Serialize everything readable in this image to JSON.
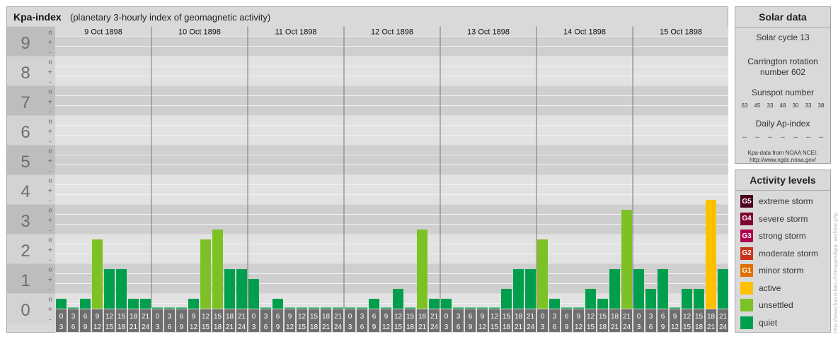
{
  "header": {
    "title": "Kpa-index",
    "subtitle": "(planetary 3-hourly index of geomagnetic activity)"
  },
  "chart_data": {
    "type": "bar",
    "y_levels": [
      "0",
      "1",
      "2",
      "3",
      "4",
      "5",
      "6",
      "7",
      "8",
      "9"
    ],
    "sub_marks": [
      "o",
      "+",
      "-"
    ],
    "ylim": [
      0,
      9
    ],
    "days": [
      "9 Oct 1898",
      "10 Oct 1898",
      "11 Oct 1898",
      "12 Oct 1898",
      "13 Oct 1898",
      "14 Oct 1898",
      "15 Oct 1898"
    ],
    "interval_labels": [
      {
        "from": "0",
        "to": "3"
      },
      {
        "from": "3",
        "to": "6"
      },
      {
        "from": "6",
        "to": "9"
      },
      {
        "from": "9",
        "to": "12"
      },
      {
        "from": "12",
        "to": "15"
      },
      {
        "from": "15",
        "to": "18"
      },
      {
        "from": "18",
        "to": "21"
      },
      {
        "from": "21",
        "to": "24"
      }
    ],
    "values": [
      0.333,
      0,
      0.333,
      2.333,
      1.333,
      1.333,
      0.333,
      0.333,
      0,
      0,
      0,
      0.333,
      2.333,
      2.667,
      1.333,
      1.333,
      1,
      0,
      0.333,
      0,
      0,
      0,
      0,
      0,
      0,
      0,
      0.333,
      0,
      0.667,
      0,
      2.667,
      0.333,
      0.333,
      0,
      0,
      0,
      0,
      0.667,
      1.333,
      1.333,
      2.333,
      0.333,
      0,
      0,
      0.667,
      0.333,
      1.333,
      3.333,
      1.333,
      0.667,
      1.333,
      0,
      0.667,
      0.667,
      3.667,
      1.333
    ]
  },
  "levels": {
    "quiet": {
      "label": "quiet",
      "color": "#009f4d"
    },
    "unsettled": {
      "label": "unsettled",
      "color": "#7cc225"
    },
    "active": {
      "label": "active",
      "color": "#ffc000"
    }
  },
  "solar": {
    "title": "Solar data",
    "cycle": "Solar cycle 13",
    "carrington_line1": "Carrington rotation",
    "carrington_line2": "number 602",
    "sunspot_title": "Sunspot number",
    "sunspots": [
      "63",
      "45",
      "33",
      "48",
      "30",
      "33",
      "38"
    ],
    "ap_title": "Daily Ap-index",
    "ap_values": [
      "--",
      "--",
      "--",
      "--",
      "--",
      "--",
      "--"
    ],
    "credit_line1": "Kpa-data from NOAA NCEI:",
    "credit_line2": "http://www.ngdc.noaa.gov/"
  },
  "activity": {
    "title": "Activity levels",
    "items": [
      {
        "badge": "G5",
        "label": "extreme storm",
        "color": "#4a0020"
      },
      {
        "badge": "G4",
        "label": "severe storm",
        "color": "#7b0032"
      },
      {
        "badge": "G3",
        "label": "strong storm",
        "color": "#b0004e"
      },
      {
        "badge": "G2",
        "label": "moderate storm",
        "color": "#c8331a"
      },
      {
        "badge": "G1",
        "label": "minor storm",
        "color": "#e07000"
      },
      {
        "badge": "",
        "label": "active",
        "color": "#ffc000"
      },
      {
        "badge": "",
        "label": "unsettled",
        "color": "#7cc225"
      },
      {
        "badge": "",
        "label": "quiet",
        "color": "#009f4d"
      }
    ]
  },
  "watermark": "http://www.fourmilab.ch/images/kpa_archive.php"
}
